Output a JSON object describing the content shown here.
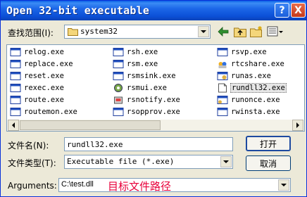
{
  "title": "Open 32-bit executable",
  "titlebar_buttons": {
    "help": "?",
    "close": "X"
  },
  "look_in": {
    "label": "查找范围(I):",
    "value": "system32"
  },
  "toolbar_icons": [
    "back-arrow-icon",
    "up-folder-icon",
    "new-folder-icon",
    "view-menu-icon"
  ],
  "files": [
    [
      "relog.exe",
      "rsh.exe",
      "rsvp.exe"
    ],
    [
      "replace.exe",
      "rsm.exe",
      "rtcshare.exe"
    ],
    [
      "reset.exe",
      "rsmsink.exe",
      "runas.exe"
    ],
    [
      "rexec.exe",
      "rsmui.exe",
      "rundll32.exe"
    ],
    [
      "route.exe",
      "rsnotify.exe",
      "runonce.exe"
    ],
    [
      "routemon.exe",
      "rsopprov.exe",
      "rwinsta.exe"
    ]
  ],
  "selected_file": "rundll32.exe",
  "filename": {
    "label": "文件名(N):",
    "value": "rundll32.exe"
  },
  "filetype": {
    "label": "文件类型(T):",
    "value": "Executable file (*.exe)"
  },
  "buttons": {
    "open": "打开",
    "cancel": "取消"
  },
  "arguments": {
    "label": "Arguments:",
    "value": "C:\\test.dll",
    "annotation": "目标文件路径"
  },
  "colors": {
    "titlebar": "#0b4fd6",
    "annotation": "#e8003a",
    "dialog_bg": "#ece9d8"
  }
}
